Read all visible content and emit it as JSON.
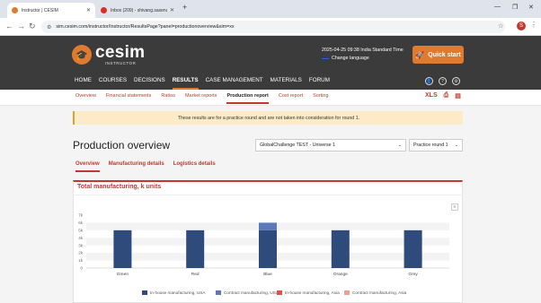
{
  "browser": {
    "tabs": [
      {
        "title": "Instructor | CESIM",
        "favicon_color": "#e07a2e"
      },
      {
        "title": "Inbox (209) - shivang.saxena@",
        "favicon_color": "#d93025"
      }
    ],
    "url": "sim.cesim.com/instructor/Instructor/ResultsPage?panel=productionoverview&sim=xx",
    "profile_initial": "S"
  },
  "app": {
    "brand": "cesim",
    "brand_sub": "INSTRUCTOR",
    "datetime": "2025-04-25 09:38 India Standard Time",
    "change_language": "Change language",
    "quick_start": "Quick start",
    "nav": [
      "HOME",
      "COURSES",
      "DECISIONS",
      "RESULTS",
      "CASE MANAGEMENT",
      "MATERIALS",
      "FORUM"
    ],
    "nav_active": "RESULTS",
    "subnav": [
      "Overview",
      "Financial statements",
      "Ratios",
      "Market reports",
      "Production report",
      "Cost report",
      "Sorting"
    ],
    "subnav_active": "Production report",
    "tools": [
      "XLS",
      "print-icon",
      "pdf-icon"
    ]
  },
  "notice": "These results are for a practice round and are not taken into consideration for round 1.",
  "page_title": "Production overview",
  "universe_select": "GlobalChallenge TEST - Universe 1",
  "round_select": "Practice round 1",
  "tabs": [
    "Overview",
    "Manufacturing details",
    "Logistics details"
  ],
  "tabs_active": "Overview",
  "card_title": "Total manufacturing, k units",
  "colors": {
    "accent": "#e07a2e",
    "red": "#c0392b",
    "bar_dark": "#2f4b7c",
    "bar_light": "#5b78b8"
  },
  "chart_data": {
    "type": "bar",
    "stacked": true,
    "categories": [
      "Green",
      "Red",
      "Blue",
      "Orange",
      "Grey"
    ],
    "series": [
      {
        "name": "In-house manufacturing, USA",
        "values": [
          5,
          5,
          5,
          5,
          5
        ],
        "color": "#2f4b7c"
      },
      {
        "name": "Contract manufacturing, USA",
        "values": [
          0,
          0,
          1,
          0,
          0
        ],
        "color": "#5b78b8"
      },
      {
        "name": "In-house manufacturing, Asia",
        "values": [
          0,
          0,
          0,
          0,
          0
        ],
        "color": "#d9534f"
      },
      {
        "name": "Contract manufacturing, Asia",
        "values": [
          0,
          0,
          0,
          0,
          0
        ],
        "color": "#f0a090"
      }
    ],
    "yticks": [
      "0",
      "1k",
      "2k",
      "3k",
      "4k",
      "5k",
      "6k",
      "7k"
    ],
    "ylim": [
      0,
      7
    ],
    "grid": true,
    "legend": "bottom"
  }
}
